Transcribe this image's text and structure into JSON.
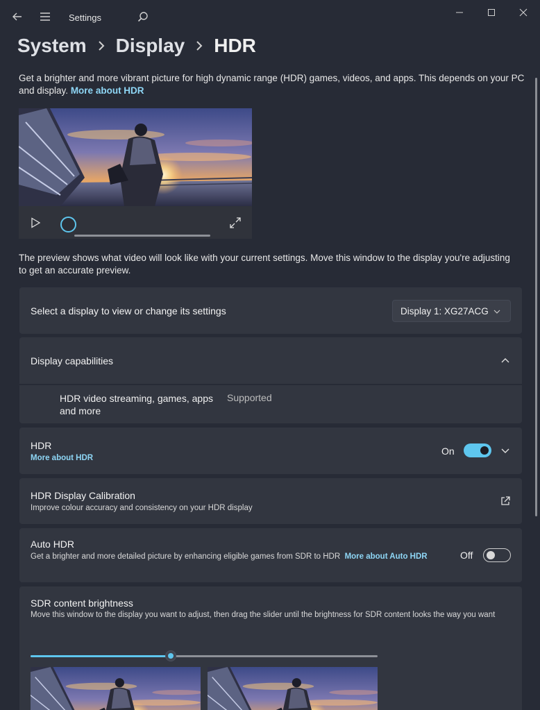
{
  "titlebar": {
    "app_title": "Settings",
    "back_icon": "back-arrow-icon",
    "menu_icon": "hamburger-menu-icon",
    "search_icon": "search-icon",
    "window_controls": [
      "minimize-icon",
      "maximize-icon",
      "close-icon"
    ]
  },
  "breadcrumb": {
    "items": [
      "System",
      "Display",
      "HDR"
    ],
    "separator_icon": "chevron-right-icon"
  },
  "intro": {
    "text": "Get a brighter and more vibrant picture for high dynamic range (HDR) games, videos, and apps. This depends on your PC and display.",
    "link": "More about HDR"
  },
  "video_preview": {
    "play_icon": "play-icon",
    "fullscreen_icon": "expand-icon",
    "progress": 0
  },
  "preview_note": "The preview shows what video will look like with your current settings. Move this window to the display you're adjusting to get an accurate preview.",
  "display_select": {
    "label": "Select a display to view or change its settings",
    "selected": "Display 1: XG27ACG",
    "chevron_icon": "chevron-down-icon"
  },
  "capabilities": {
    "title": "Display capabilities",
    "collapse_icon": "chevron-up-icon",
    "feature": "HDR video streaming, games, apps and more",
    "status": "Supported"
  },
  "hdr": {
    "title": "HDR",
    "link": "More about HDR",
    "state_label": "On",
    "enabled": true,
    "expand_icon": "chevron-down-icon"
  },
  "calibration": {
    "title": "HDR Display Calibration",
    "subtitle": "Improve colour accuracy and consistency on your HDR display",
    "open_icon": "open-external-icon"
  },
  "auto_hdr": {
    "title": "Auto HDR",
    "subtitle": "Get a brighter and more detailed picture by enhancing eligible games from SDR to HDR",
    "link": "More about Auto HDR",
    "state_label": "Off",
    "enabled": false
  },
  "sdr_brightness": {
    "title": "SDR content brightness",
    "subtitle": "Move this window to the display you want to adjust, then drag the slider until the brightness for SDR content looks the way you want",
    "level": 0.4
  },
  "colors": {
    "background": "#272b36",
    "card": "#323640",
    "accent": "#5ec6ee",
    "link": "#8ed6f5"
  }
}
